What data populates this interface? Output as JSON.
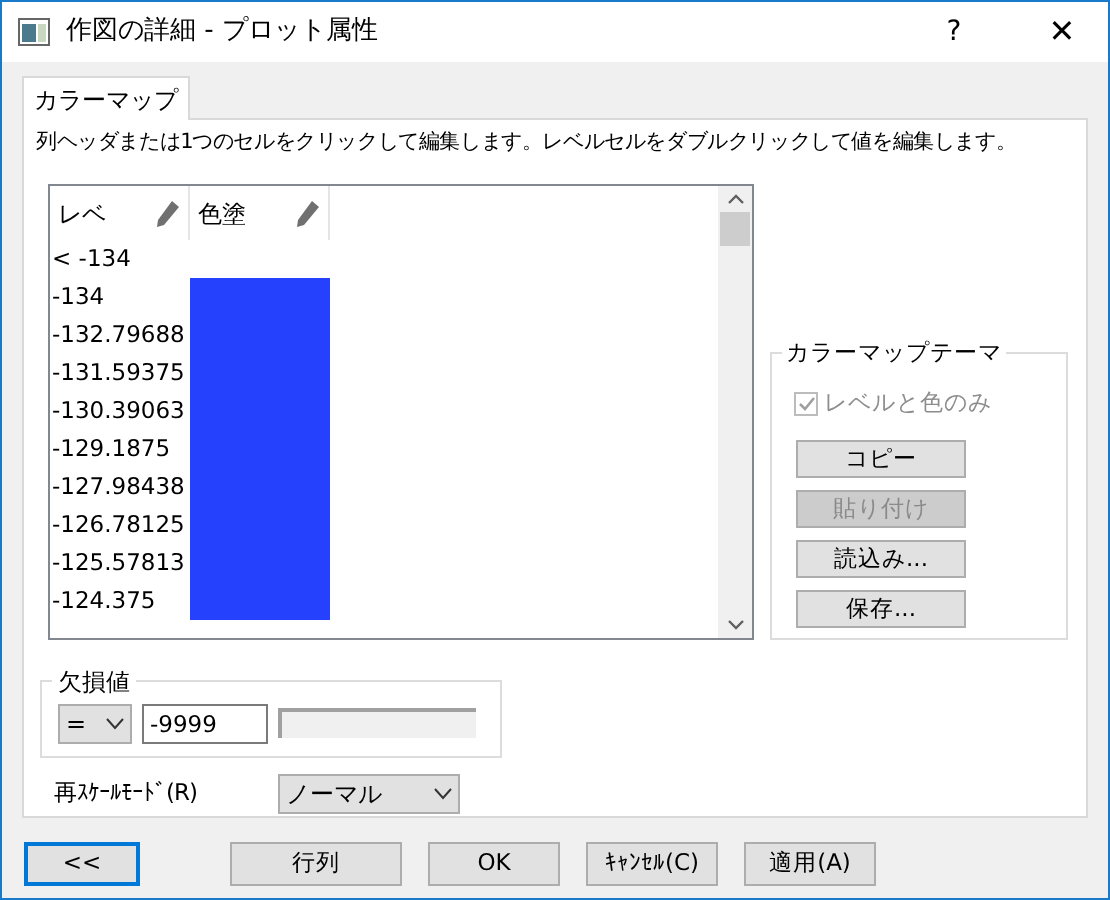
{
  "window": {
    "title": "作図の詳細 - プロット属性",
    "help": "?",
    "close": "✕"
  },
  "tabs": [
    {
      "label": "カラーマップ",
      "selected": true
    }
  ],
  "instruction": "列ヘッダまたは1つのセルをクリックして編集します。レベルセルをダブルクリックして値を編集します。",
  "table": {
    "columns": [
      "レベ",
      "色塗"
    ],
    "rows": [
      {
        "level": "< -134",
        "color": null
      },
      {
        "level": "-134",
        "color": "#2541fe"
      },
      {
        "level": "-132.79688",
        "color": "#2541fe"
      },
      {
        "level": "-131.59375",
        "color": "#2541fe"
      },
      {
        "level": "-130.39063",
        "color": "#2541fe"
      },
      {
        "level": "-129.1875",
        "color": "#2541fe"
      },
      {
        "level": "-127.98438",
        "color": "#2541fe"
      },
      {
        "level": "-126.78125",
        "color": "#2541fe"
      },
      {
        "level": "-125.57813",
        "color": "#2541fe"
      },
      {
        "level": "-124.375",
        "color": "#2541fe"
      }
    ]
  },
  "theme": {
    "title": "カラーマップテーマ",
    "checkbox": {
      "label": "レベルと色のみ",
      "checked": true,
      "disabled": true
    },
    "buttons": [
      {
        "label": "コピー",
        "disabled": false
      },
      {
        "label": "貼り付け",
        "disabled": true
      },
      {
        "label": "読込み...",
        "disabled": false
      },
      {
        "label": "保存...",
        "disabled": false
      }
    ]
  },
  "missing": {
    "title": "欠損値",
    "operator": "=",
    "value": "-9999"
  },
  "rescale": {
    "label": "再ｽｹｰﾙﾓｰﾄﾞ(R)",
    "value": "ノーマル"
  },
  "footer": [
    {
      "label": "<<",
      "focused": true
    },
    {
      "label": "行列",
      "focused": false
    },
    {
      "label": "OK",
      "focused": false
    },
    {
      "label": "ｷｬﾝｾﾙ(C)",
      "focused": false
    },
    {
      "label": "適用(A)",
      "focused": false
    }
  ]
}
